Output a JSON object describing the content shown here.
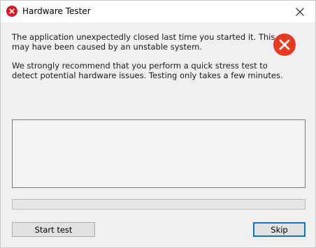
{
  "window": {
    "title": "Hardware Tester",
    "title_icon": "error-icon"
  },
  "message": {
    "line1": "The application unexpectedly closed last time you started it. This",
    "line2": "may have been caused by an unstable system.",
    "line3": "We strongly recommend that you perform a quick stress test to",
    "line4": "detect potential hardware issues. Testing only takes a few minutes."
  },
  "status_icon": "error-icon",
  "log": {
    "content": ""
  },
  "progress": {
    "value": 0
  },
  "buttons": {
    "start_label": "Start test",
    "skip_label": "Skip"
  },
  "colors": {
    "error_red": "#e81123",
    "accent_blue": "#0078d7",
    "progress_green": "#06b025"
  }
}
